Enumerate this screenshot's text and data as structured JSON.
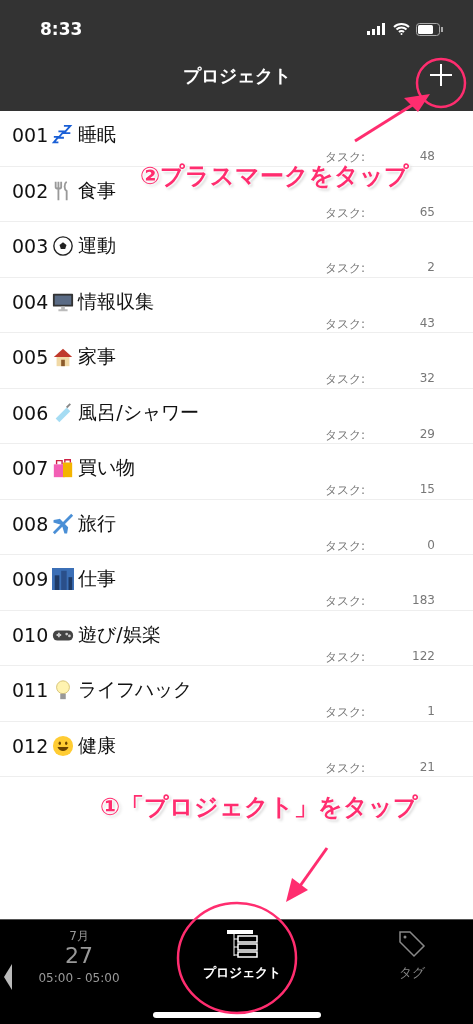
{
  "status_bar": {
    "time": "8:33"
  },
  "nav": {
    "title": "プロジェクト"
  },
  "projects": [
    {
      "number": "001",
      "name": "睡眠",
      "task_label": "タスク:",
      "count": "48"
    },
    {
      "number": "002",
      "name": "食事",
      "task_label": "タスク:",
      "count": "65"
    },
    {
      "number": "003",
      "name": "運動",
      "task_label": "タスク:",
      "count": "2"
    },
    {
      "number": "004",
      "name": "情報収集",
      "task_label": "タスク:",
      "count": "43"
    },
    {
      "number": "005",
      "name": "家事",
      "task_label": "タスク:",
      "count": "32"
    },
    {
      "number": "006",
      "name": "風呂/シャワー",
      "task_label": "タスク:",
      "count": "29"
    },
    {
      "number": "007",
      "name": "買い物",
      "task_label": "タスク:",
      "count": "15"
    },
    {
      "number": "008",
      "name": "旅行",
      "task_label": "タスク:",
      "count": "0"
    },
    {
      "number": "009",
      "name": "仕事",
      "task_label": "タスク:",
      "count": "183"
    },
    {
      "number": "010",
      "name": "遊び/娯楽",
      "task_label": "タスク:",
      "count": "122"
    },
    {
      "number": "011",
      "name": "ライフハック",
      "task_label": "タスク:",
      "count": "1"
    },
    {
      "number": "012",
      "name": "健康",
      "task_label": "タスク:",
      "count": "21"
    }
  ],
  "tab_bar": {
    "date": {
      "month": "7月",
      "day": "27",
      "range": "05:00 - 05:00"
    },
    "tabs": [
      {
        "label": "プロジェクト",
        "selected": true
      },
      {
        "label": "タグ",
        "selected": false
      }
    ]
  },
  "annotations": [
    {
      "text": "②プラスマークをタップ"
    },
    {
      "text": "①「プロジェクト」をタップ"
    }
  ]
}
